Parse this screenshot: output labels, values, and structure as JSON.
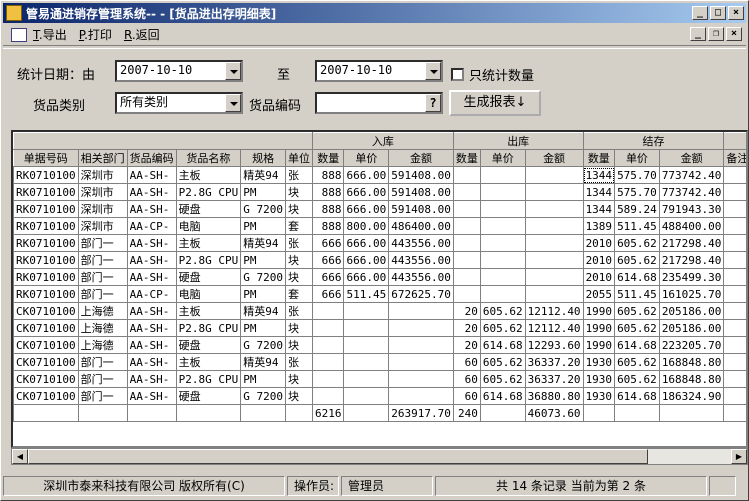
{
  "window": {
    "title": "管易通进销存管理系统--  - [货品进出存明细表]",
    "min_glyph": "_",
    "max_glyph": "□",
    "close_glyph": "×",
    "mdi_min_glyph": "_",
    "mdi_restore_glyph": "❐",
    "mdi_close_glyph": "×"
  },
  "menu": {
    "export_key": "T",
    "export_label": ".导出",
    "print_key": "P",
    "print_label": ".打印",
    "back_key": "R",
    "back_label": ".返回"
  },
  "filter": {
    "date_label": "统计日期：由",
    "date_from": "2007-10-10",
    "to_label": "至",
    "date_to": "2007-10-10",
    "qty_only_label": "只统计数量",
    "category_label": "货品类别",
    "category_value": "所有类别",
    "code_label": "货品编码",
    "code_value": "",
    "query_glyph": "?",
    "generate_button": "生成报表↓"
  },
  "table": {
    "groups": [
      "入库",
      "出库",
      "结存"
    ],
    "columns": [
      "单据号码",
      "相关部门",
      "货品编码",
      "货品名称",
      "规格",
      "单位",
      "数量",
      "单价",
      "金额",
      "数量",
      "单价",
      "金额",
      "数量",
      "单价",
      "金额",
      "备注"
    ],
    "rows": [
      [
        "RK0710100",
        "深圳市",
        "AA-SH-",
        "主板",
        "精英94",
        "张",
        "888",
        "666.00",
        "591408.00",
        "",
        "",
        "",
        "1344",
        "575.70",
        "773742.40",
        ""
      ],
      [
        "RK0710100",
        "深圳市",
        "AA-SH-",
        "P2.8G CPU",
        "PM",
        "块",
        "888",
        "666.00",
        "591408.00",
        "",
        "",
        "",
        "1344",
        "575.70",
        "773742.40",
        ""
      ],
      [
        "RK0710100",
        "深圳市",
        "AA-SH-",
        "硬盘",
        "G 7200",
        "块",
        "888",
        "666.00",
        "591408.00",
        "",
        "",
        "",
        "1344",
        "589.24",
        "791943.30",
        ""
      ],
      [
        "RK0710100",
        "深圳市",
        "AA-CP-",
        "电脑",
        "PM",
        "套",
        "888",
        "800.00",
        "486400.00",
        "",
        "",
        "",
        "1389",
        "511.45",
        "488400.00",
        ""
      ],
      [
        "RK0710100",
        "部门一",
        "AA-SH-",
        "主板",
        "精英94",
        "张",
        "666",
        "666.00",
        "443556.00",
        "",
        "",
        "",
        "2010",
        "605.62",
        "217298.40",
        ""
      ],
      [
        "RK0710100",
        "部门一",
        "AA-SH-",
        "P2.8G CPU",
        "PM",
        "块",
        "666",
        "666.00",
        "443556.00",
        "",
        "",
        "",
        "2010",
        "605.62",
        "217298.40",
        ""
      ],
      [
        "RK0710100",
        "部门一",
        "AA-SH-",
        "硬盘",
        "G 7200",
        "块",
        "666",
        "666.00",
        "443556.00",
        "",
        "",
        "",
        "2010",
        "614.68",
        "235499.30",
        ""
      ],
      [
        "RK0710100",
        "部门一",
        "AA-CP-",
        "电脑",
        "PM",
        "套",
        "666",
        "511.45",
        "672625.70",
        "",
        "",
        "",
        "2055",
        "511.45",
        "161025.70",
        ""
      ],
      [
        "CK0710100",
        "上海德",
        "AA-SH-",
        "主板",
        "精英94",
        "张",
        "",
        "",
        "",
        "20",
        "605.62",
        "12112.40",
        "1990",
        "605.62",
        "205186.00",
        ""
      ],
      [
        "CK0710100",
        "上海德",
        "AA-SH-",
        "P2.8G CPU",
        "PM",
        "块",
        "",
        "",
        "",
        "20",
        "605.62",
        "12112.40",
        "1990",
        "605.62",
        "205186.00",
        ""
      ],
      [
        "CK0710100",
        "上海德",
        "AA-SH-",
        "硬盘",
        "G 7200",
        "块",
        "",
        "",
        "",
        "20",
        "614.68",
        "12293.60",
        "1990",
        "614.68",
        "223205.70",
        ""
      ],
      [
        "CK0710100",
        "部门一",
        "AA-SH-",
        "主板",
        "精英94",
        "张",
        "",
        "",
        "",
        "60",
        "605.62",
        "36337.20",
        "1930",
        "605.62",
        "168848.80",
        ""
      ],
      [
        "CK0710100",
        "部门一",
        "AA-SH-",
        "P2.8G CPU",
        "PM",
        "块",
        "",
        "",
        "",
        "60",
        "605.62",
        "36337.20",
        "1930",
        "605.62",
        "168848.80",
        ""
      ],
      [
        "CK0710100",
        "部门一",
        "AA-SH-",
        "硬盘",
        "G 7200",
        "块",
        "",
        "",
        "",
        "60",
        "614.68",
        "36880.80",
        "1930",
        "614.68",
        "186324.90",
        ""
      ]
    ],
    "total_row": [
      "",
      "",
      "",
      "",
      "",
      "",
      "6216",
      "",
      "263917.70",
      "240",
      "",
      "46073.60",
      "",
      "",
      "",
      ""
    ]
  },
  "statusbar": {
    "company": "深圳市泰来科技有限公司 版权所有(C)",
    "operator_label": "操作员:",
    "operator": "管理员",
    "record_info": "共 14 条记录 当前为第 2 条"
  }
}
